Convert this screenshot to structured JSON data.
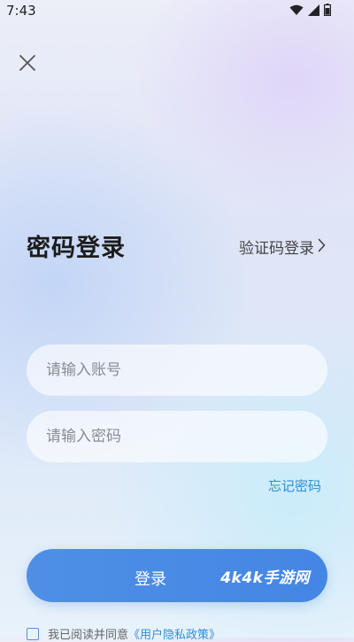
{
  "status_bar": {
    "time": "7:43",
    "icons": [
      "wifi-icon",
      "cell-signal-icon",
      "battery-icon"
    ]
  },
  "header": {
    "close_icon": "close-icon"
  },
  "login": {
    "title": "密码登录",
    "switch_label": "验证码登录",
    "switch_icon": "chevron-right-icon",
    "account_placeholder": "请输入账号",
    "password_placeholder": "请输入密码",
    "forgot_label": "忘记密码",
    "submit_label": "登录",
    "watermark": "4k4k手游网"
  },
  "agreement": {
    "text": "我已阅读并同意",
    "link": "《用户隐私政策》"
  },
  "colors": {
    "accent": "#4a8ae5",
    "link": "#2f8fd3",
    "title": "#1c1c1c"
  }
}
